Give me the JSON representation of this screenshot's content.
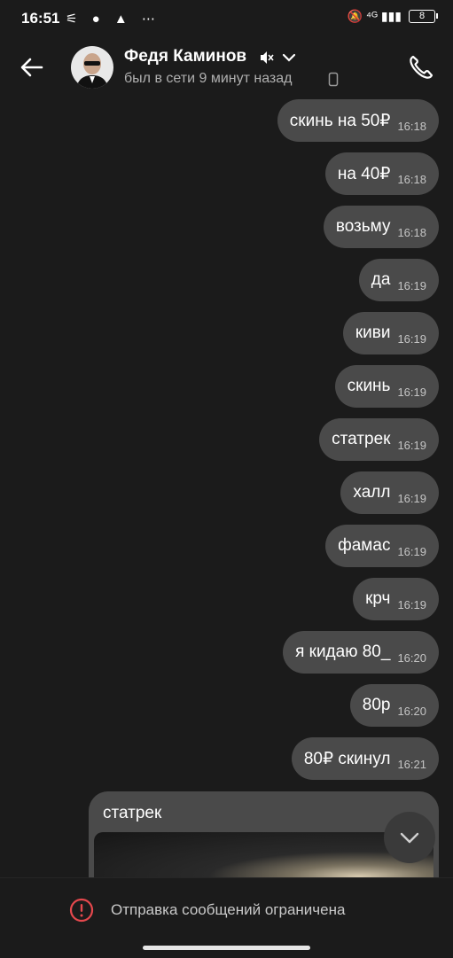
{
  "status_bar": {
    "time": "16:51",
    "left_icons": "⚟ ● ▲ ⋯",
    "right_icons": "🔕 ⁴ᴳ ▮▮▮",
    "battery": "8"
  },
  "header": {
    "contact_name": "Федя Каминов",
    "last_seen": "был в сети 9 минут назад",
    "icons": [
      "back-icon",
      "avatar",
      "mute-icon",
      "chevron-down-icon",
      "phone-small-icon",
      "call-icon"
    ]
  },
  "messages": [
    {
      "text": "скинь на 50₽",
      "time": "16:18"
    },
    {
      "text": "на 40₽",
      "time": "16:18"
    },
    {
      "text": "возьму",
      "time": "16:18"
    },
    {
      "text": "да",
      "time": "16:19"
    },
    {
      "text": "киви",
      "time": "16:19"
    },
    {
      "text": "скинь",
      "time": "16:19"
    },
    {
      "text": "статрек",
      "time": "16:19"
    },
    {
      "text": "халл",
      "time": "16:19"
    },
    {
      "text": "фамас",
      "time": "16:19"
    },
    {
      "text": "крч",
      "time": "16:19"
    },
    {
      "text": "я кидаю 80_",
      "time": "16:20"
    },
    {
      "text": "80р",
      "time": "16:20"
    },
    {
      "text": "80₽ скинул",
      "time": "16:21"
    }
  ],
  "media_message": {
    "caption": "статрек"
  },
  "bottom_bar": {
    "restriction_text": "Отправка сообщений ограничена"
  },
  "colors": {
    "background": "#1b1b1b",
    "bubble": "#4a4a4a",
    "error": "#e5484d"
  }
}
